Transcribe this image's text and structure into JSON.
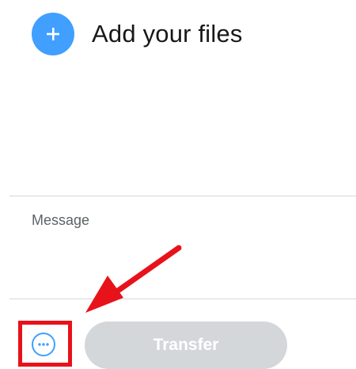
{
  "upload": {
    "add_label": "Add your files",
    "icon": "plus-icon"
  },
  "message": {
    "placeholder": "Message",
    "value": ""
  },
  "footer": {
    "options_icon": "ellipsis-circle-icon",
    "transfer_label": "Transfer",
    "transfer_enabled": false
  },
  "annotation": {
    "color": "#e8121a",
    "target": "options-button"
  },
  "colors": {
    "accent": "#409fff",
    "disabled_button": "#d4d7d9",
    "divider": "#d4d7d9"
  }
}
